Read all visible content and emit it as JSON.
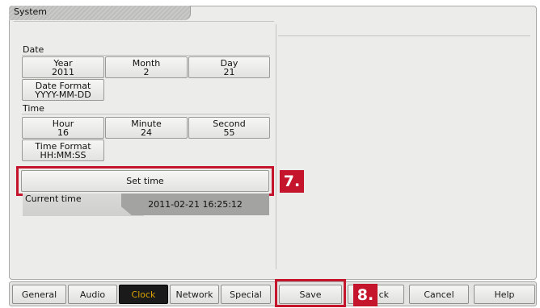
{
  "window": {
    "title": "System"
  },
  "date_section": {
    "label": "Date",
    "year": {
      "label": "Year",
      "value": "2011"
    },
    "month": {
      "label": "Month",
      "value": "2"
    },
    "day": {
      "label": "Day",
      "value": "21"
    },
    "date_format": {
      "label": "Date Format",
      "value": "YYYY-MM-DD"
    }
  },
  "time_section": {
    "label": "Time",
    "hour": {
      "label": "Hour",
      "value": "16"
    },
    "minute": {
      "label": "Minute",
      "value": "24"
    },
    "second": {
      "label": "Second",
      "value": "55"
    },
    "time_format": {
      "label": "Time Format",
      "value": "HH:MM:SS"
    }
  },
  "set_time_button": "Set time",
  "current_time": {
    "label": "Current time",
    "value": "2011-02-21 16:25:12"
  },
  "callouts": {
    "step7": "7.",
    "step8": "8."
  },
  "tabs": [
    {
      "label": "General"
    },
    {
      "label": "Audio"
    },
    {
      "label": "Clock"
    },
    {
      "label": "Network"
    },
    {
      "label": "Special"
    }
  ],
  "actions": {
    "save": "Save",
    "back": "ck",
    "cancel": "Cancel",
    "help": "Help"
  },
  "colors": {
    "highlight_red": "#c5152d",
    "active_tab_bg": "#1a1a1a",
    "active_tab_text": "#d9a300"
  }
}
